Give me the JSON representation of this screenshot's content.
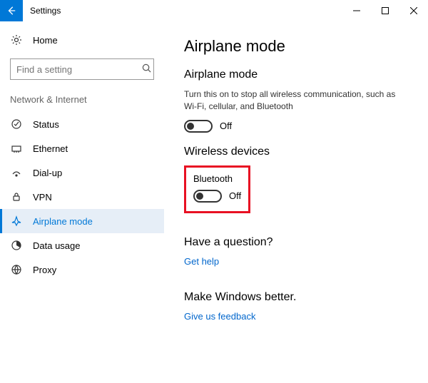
{
  "titlebar": {
    "title": "Settings"
  },
  "sidebar": {
    "home": "Home",
    "search_placeholder": "Find a setting",
    "group": "Network & Internet",
    "items": [
      {
        "label": "Status"
      },
      {
        "label": "Ethernet"
      },
      {
        "label": "Dial-up"
      },
      {
        "label": "VPN"
      },
      {
        "label": "Airplane mode"
      },
      {
        "label": "Data usage"
      },
      {
        "label": "Proxy"
      }
    ]
  },
  "content": {
    "heading": "Airplane mode",
    "airplane": {
      "title": "Airplane mode",
      "desc": "Turn this on to stop all wireless communication, such as Wi-Fi, cellular, and Bluetooth",
      "state": "Off"
    },
    "wireless": {
      "title": "Wireless devices",
      "bluetooth_label": "Bluetooth",
      "bluetooth_state": "Off"
    },
    "question": {
      "title": "Have a question?",
      "link": "Get help"
    },
    "feedback": {
      "title": "Make Windows better.",
      "link": "Give us feedback"
    }
  }
}
